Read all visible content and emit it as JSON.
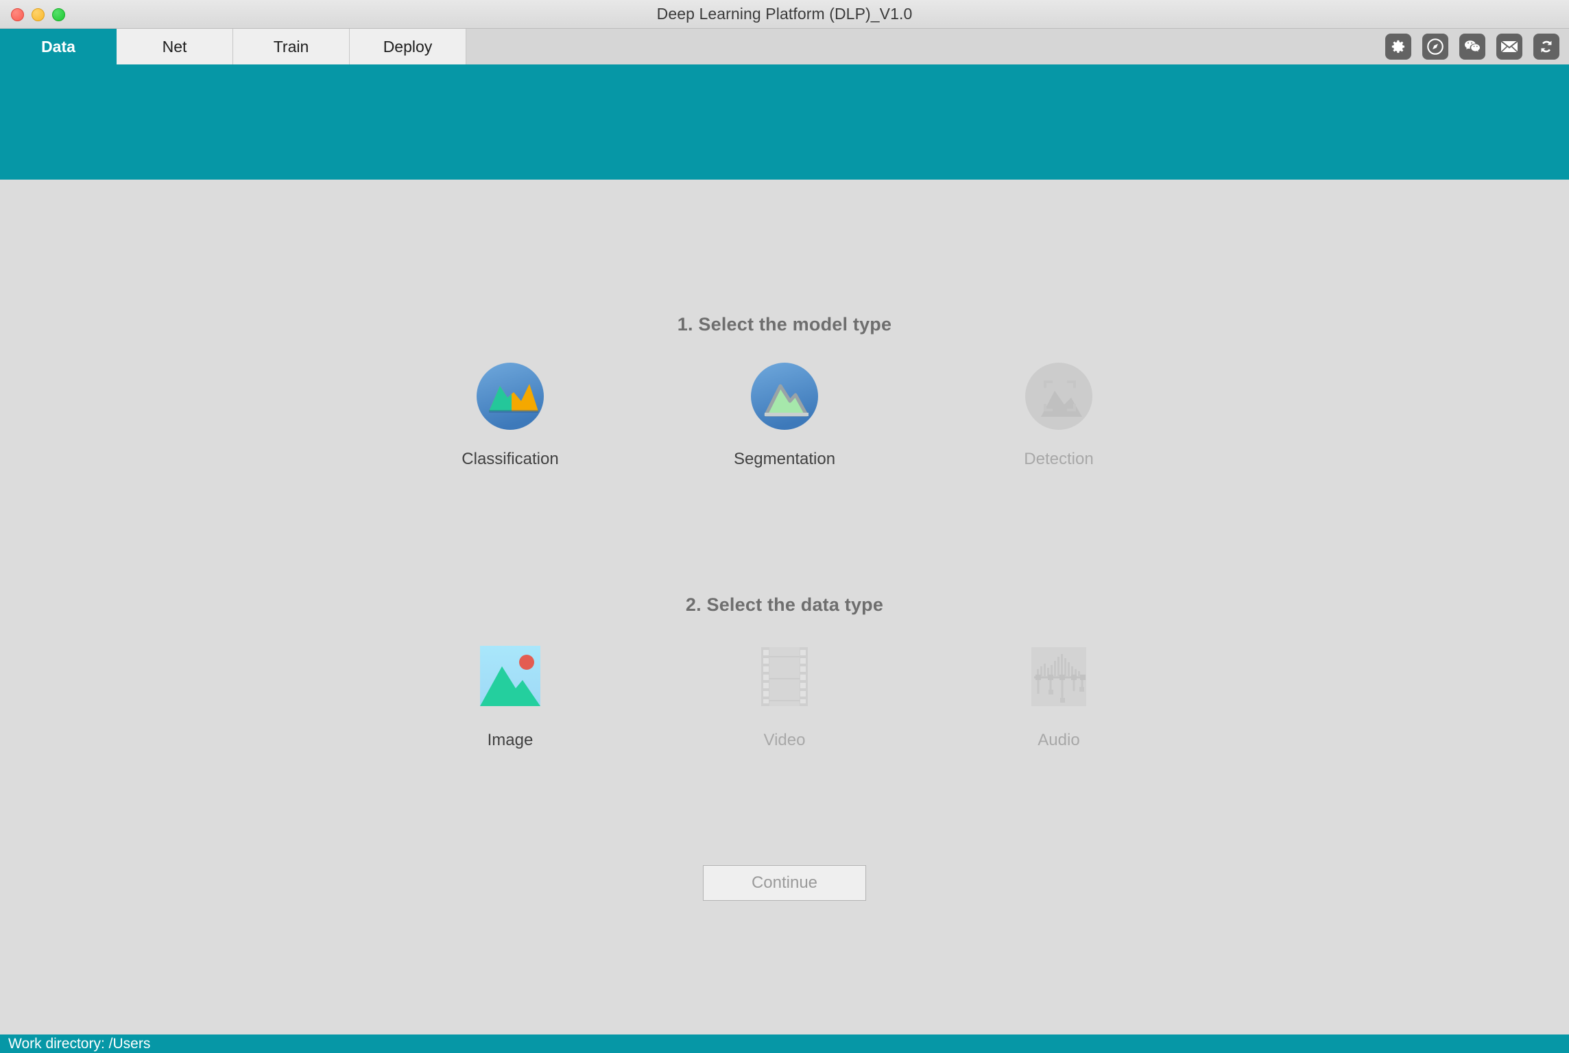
{
  "window": {
    "title": "Deep Learning Platform (DLP)_V1.0",
    "traffic_lights": [
      "close-button",
      "minimize-button",
      "maximize-button"
    ]
  },
  "tabs": [
    {
      "label": "Data",
      "name": "tab-data",
      "active": true
    },
    {
      "label": "Net",
      "name": "tab-net",
      "active": false
    },
    {
      "label": "Train",
      "name": "tab-train",
      "active": false
    },
    {
      "label": "Deploy",
      "name": "tab-deploy",
      "active": false
    }
  ],
  "toolbar": {
    "icons": [
      {
        "name": "gear-icon",
        "title": "Settings"
      },
      {
        "name": "compass-icon",
        "title": "Browser"
      },
      {
        "name": "wechat-icon",
        "title": "WeChat"
      },
      {
        "name": "mail-icon",
        "title": "Mail"
      },
      {
        "name": "sync-icon",
        "title": "Refresh"
      }
    ]
  },
  "main": {
    "model_section": {
      "title": "1. Select the model type",
      "options": [
        {
          "label": "Classification",
          "name": "option-classification",
          "enabled": true,
          "icon": "classification-icon"
        },
        {
          "label": "Segmentation",
          "name": "option-segmentation",
          "enabled": true,
          "icon": "segmentation-icon"
        },
        {
          "label": "Detection",
          "name": "option-detection",
          "enabled": false,
          "icon": "detection-icon"
        }
      ]
    },
    "data_section": {
      "title": "2. Select the data type",
      "options": [
        {
          "label": "Image",
          "name": "option-image",
          "enabled": true,
          "icon": "image-icon"
        },
        {
          "label": "Video",
          "name": "option-video",
          "enabled": false,
          "icon": "video-icon"
        },
        {
          "label": "Audio",
          "name": "option-audio",
          "enabled": false,
          "icon": "audio-icon"
        }
      ]
    },
    "continue_button": {
      "label": "Continue",
      "enabled": false
    }
  },
  "statusbar": {
    "text": "Work directory:  /Users"
  },
  "colors": {
    "accent_teal": "#0697a6",
    "content_bg": "#dcdcdc",
    "tab_inactive": "#efefef",
    "title_text": "#3a3a3a",
    "disabled_text": "#a8a8a8"
  }
}
